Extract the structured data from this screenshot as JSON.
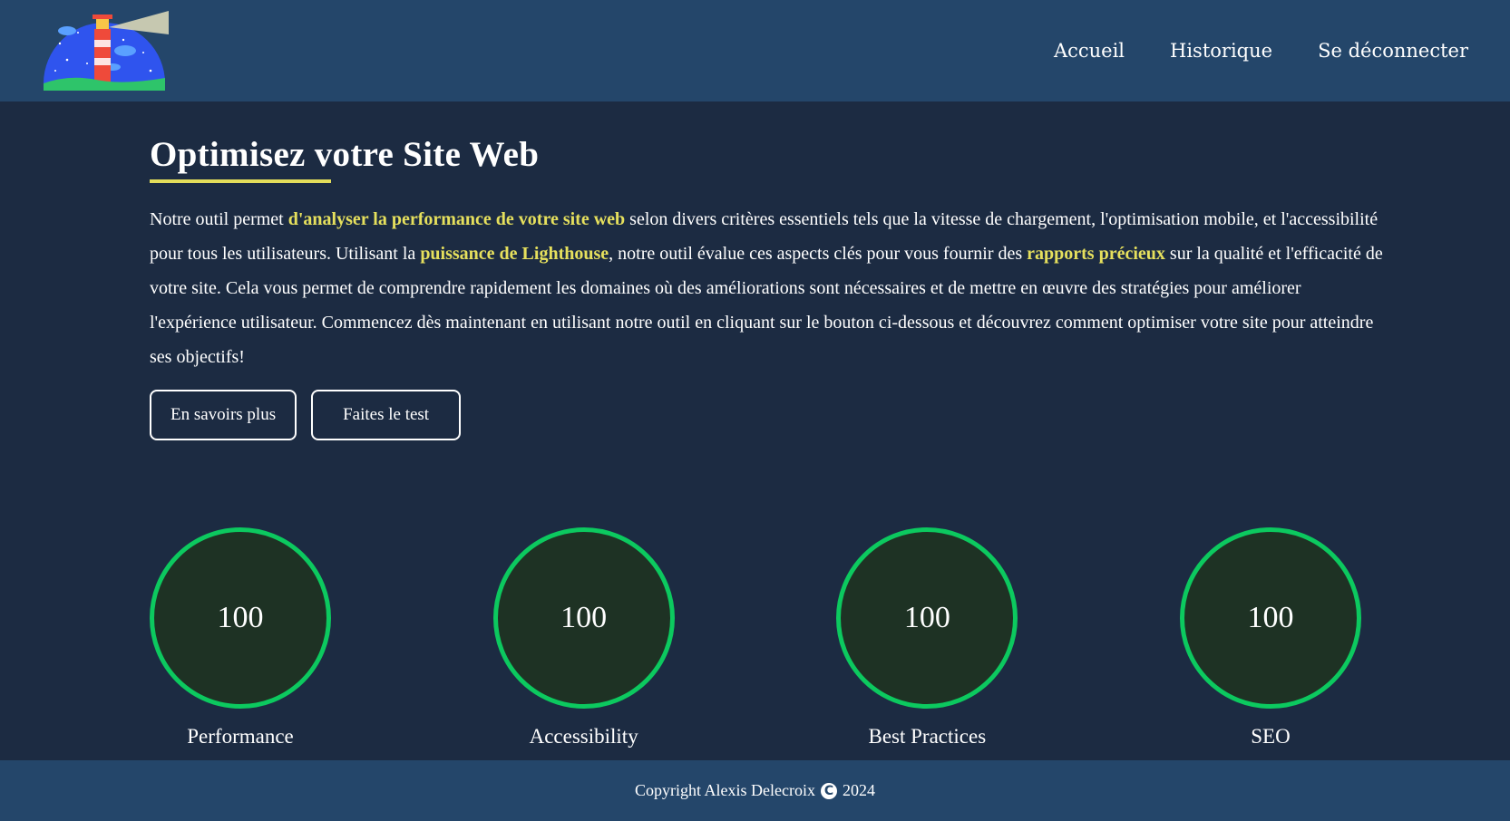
{
  "header": {
    "logo_name": "lighthouse-logo",
    "nav": [
      {
        "label": "Accueil"
      },
      {
        "label": "Historique"
      },
      {
        "label": "Se déconnecter"
      }
    ]
  },
  "main": {
    "title": "Optimisez votre Site Web",
    "description": {
      "p1": "Notre outil permet ",
      "hl1": "d'analyser la performance de votre site web",
      "p2": " selon divers critères essentiels tels que la vitesse de chargement, l'optimisation mobile, et l'accessibilité pour tous les utilisateurs. Utilisant la ",
      "hl2": "puissance de Lighthouse",
      "p3": ", notre outil évalue ces aspects clés pour vous fournir des ",
      "hl3": "rapports précieux",
      "p4": " sur la qualité et l'efficacité de votre site. Cela vous permet de comprendre rapidement les domaines où des améliorations sont nécessaires et de mettre en œuvre des stratégies pour améliorer l'expérience utilisateur. Commencez dès maintenant en utilisant notre outil en cliquant sur le bouton ci-dessous et découvrez comment optimiser votre site pour atteindre ses objectifs!"
    },
    "buttons": {
      "learn_more": "En savoirs plus",
      "take_test": "Faites le test"
    }
  },
  "scores": [
    {
      "value": "100",
      "label": "Performance"
    },
    {
      "value": "100",
      "label": "Accessibility"
    },
    {
      "value": "100",
      "label": "Best Practices"
    },
    {
      "value": "100",
      "label": "SEO"
    }
  ],
  "colors": {
    "background": "#1c2b42",
    "header": "#24466a",
    "highlight": "#e6e05d",
    "score_ring": "#0cc95f"
  },
  "footer": {
    "text_before": "Copyright Alexis Delecroix",
    "copyright_symbol": "C",
    "year": "2024"
  }
}
